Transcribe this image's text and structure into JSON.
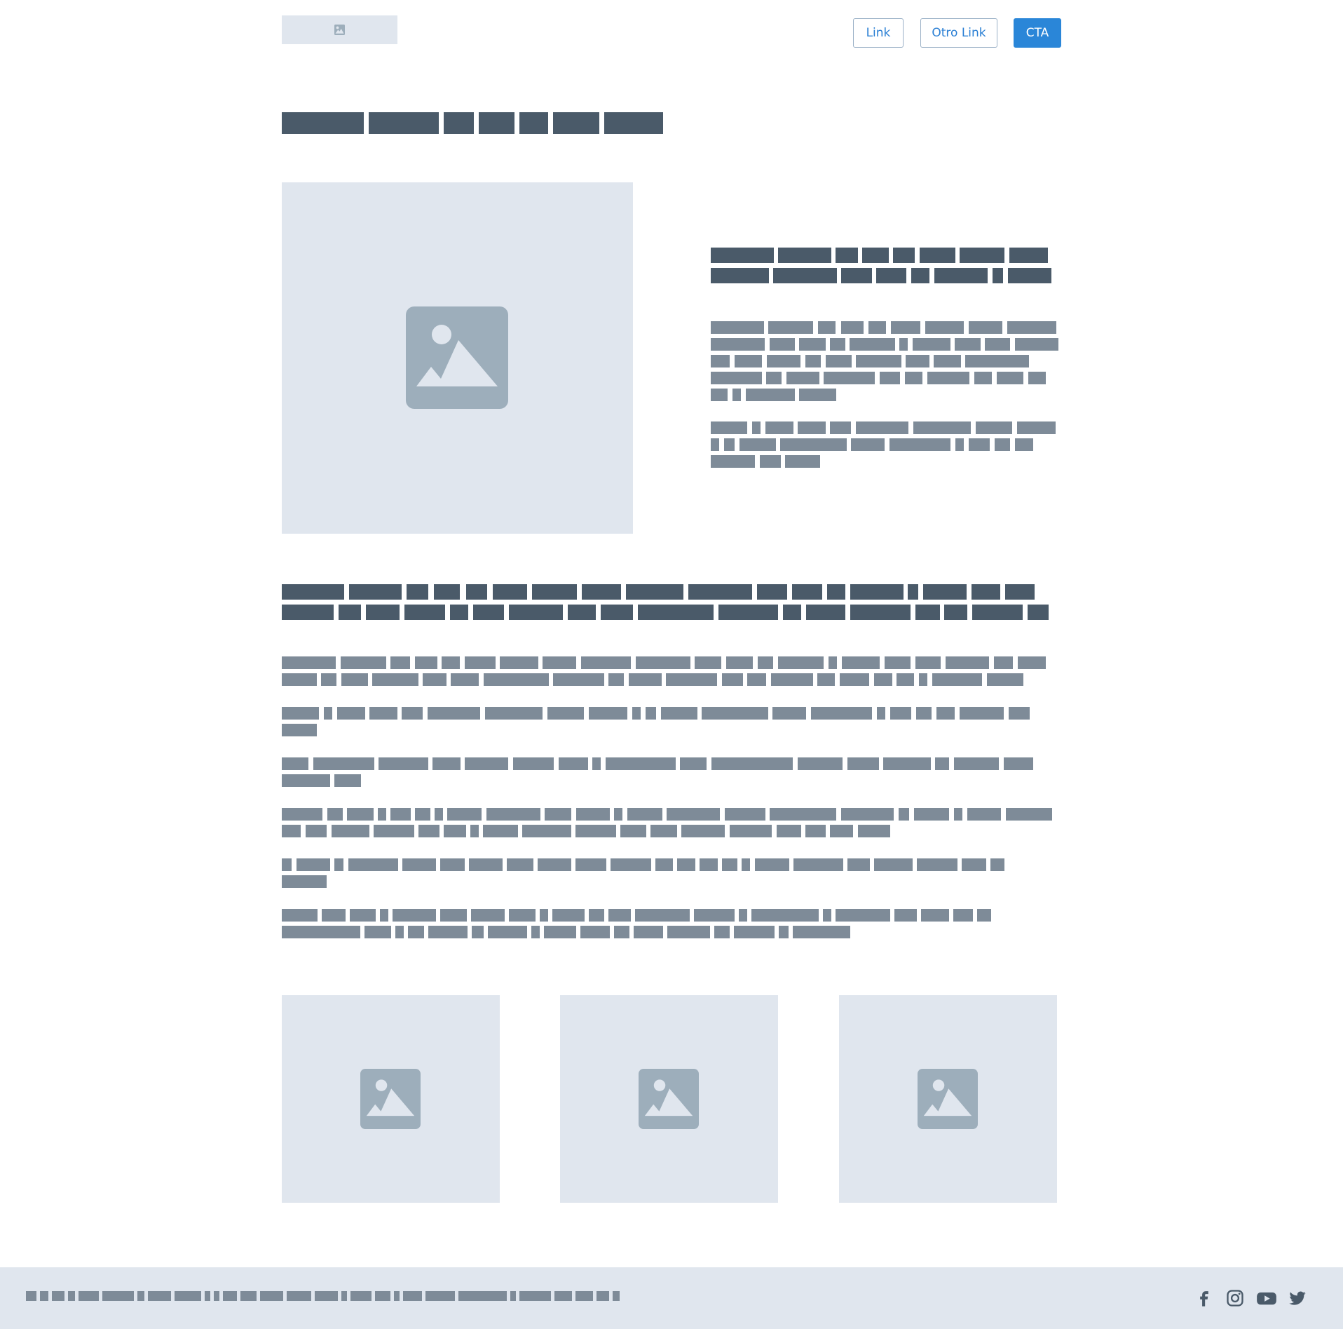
{
  "header": {
    "logo_icon": "image-icon",
    "nav": [
      {
        "label": "Link"
      },
      {
        "label": "Otro Link"
      }
    ],
    "cta_label": "CTA"
  },
  "colors": {
    "placeholder_bg": "#e0e6ee",
    "placeholder_icon": "#9daebb",
    "heading_blocks": "#4a5a69",
    "text_blocks": "#7e8b98",
    "accent": "#2a86d8"
  },
  "placeholders": {
    "logo": "image-icon",
    "hero_image": "image-icon",
    "gallery": [
      "image-icon",
      "image-icon",
      "image-icon"
    ]
  },
  "footer": {
    "social_icons": [
      "facebook-icon",
      "instagram-icon",
      "youtube-icon",
      "twitter-icon"
    ]
  }
}
